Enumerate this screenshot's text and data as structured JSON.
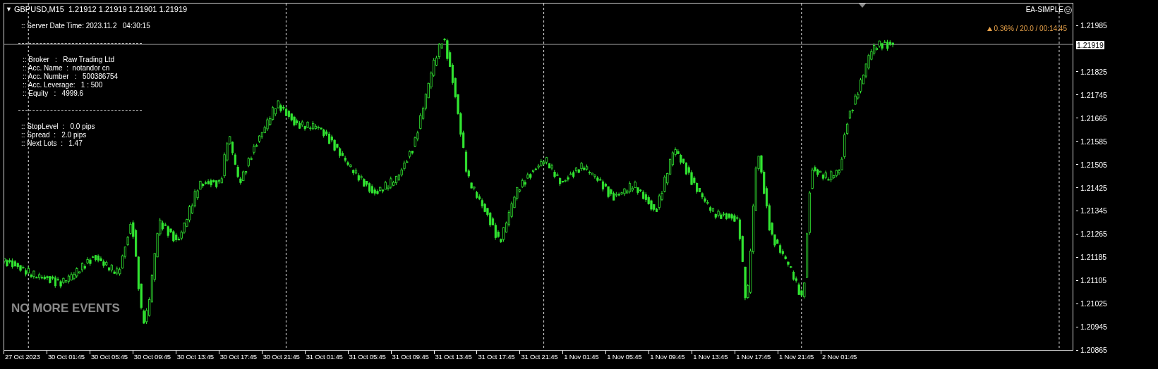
{
  "chart": {
    "toggle": "▼",
    "header": "GBPUSD,M15  1.21912 1.21919 1.21901 1.21919",
    "info_panel": {
      "server_time": ":: Server Date Time: 2023.11.2   04:30:15",
      "account_lines": [
        ":: Broker   :   Raw Trading Ltd",
        ":: Acc. Name  :  notandor cn",
        ":: Acc. Number   :   500386754",
        ":: Acc. Leverage:   1 : 500",
        ":: Equity   :   4999.6"
      ],
      "trading_lines": [
        ":: StopLevel  :   0.0 pips",
        ":: Spread  :   2.0 pips",
        ":: Next Lots  :   1.47"
      ]
    },
    "ea": {
      "name": "EA-SIMPLE",
      "status": "0.36% / 20.0 / 00:14:45"
    },
    "events_label": "NO MORE EVENTS",
    "current_price": "1.21919",
    "price_axis": [
      "1.21985",
      "1.21825",
      "1.21745",
      "1.21665",
      "1.21585",
      "1.21505",
      "1.21425",
      "1.21345",
      "1.21265",
      "1.21185",
      "1.21105",
      "1.21025",
      "1.20945",
      "1.20865"
    ],
    "time_axis": [
      "27 Oct 2023",
      "30 Oct 01:45",
      "30 Oct 05:45",
      "30 Oct 09:45",
      "30 Oct 13:45",
      "30 Oct 17:45",
      "30 Oct 21:45",
      "31 Oct 01:45",
      "31 Oct 05:45",
      "31 Oct 09:45",
      "31 Oct 13:45",
      "31 Oct 17:45",
      "31 Oct 21:45",
      "1 Nov 01:45",
      "1 Nov 05:45",
      "1 Nov 09:45",
      "1 Nov 13:45",
      "1 Nov 17:45",
      "1 Nov 21:45",
      "2 Nov 01:45"
    ]
  }
}
